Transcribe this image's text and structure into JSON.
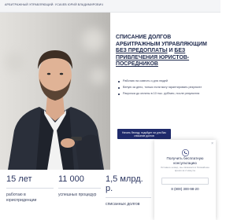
{
  "header": {
    "title": "АРБИТРАЖНЫЙ УПРАВЛЯЮЩИЙ: УСАЧЕВ ЮРИЙ ВЛАДИМИРОВИЧ"
  },
  "hero": {
    "headline_line1": "СПИСАНИЕ ДОЛГОВ АРБИТРАЖНЫМ УПРАВЛЯЮЩИМ ",
    "headline_u1": "БЕЗ ПРЕДОПЛАТЫ",
    "headline_line2": " И ",
    "headline_u2": "БЕЗ ПРИВЛЕЧЕНИЯ ЮРИСТОВ-ПОСРЕДНИКОВ",
    "bullets": [
      "Работаю на совесть и для людей",
      "Веную за дело, только если могу гарантировать результат",
      "Расрочка до оплаты в 10 тыс. руб/мес, после результата"
    ],
    "cta_label": "Начать беседу, подойдет ли для Вас списание долгов"
  },
  "stats": [
    {
      "num": "15 лет",
      "desc": "работаю в юрисприденции"
    },
    {
      "num": "11 000",
      "desc": "успешных процедур"
    },
    {
      "num": "1,5 млрд. р.",
      "desc": "списанных долгов"
    }
  ],
  "popup": {
    "title": "Получить бесплатную консультацию",
    "subtitle": "Оставьте номер, мы свяжемся в ближайшее время за 2 минуты",
    "phone": "8 (800) 300-98-20",
    "close": "×"
  },
  "colors": {
    "brand": "#1f2a6b",
    "text": "#1f2a4d"
  }
}
